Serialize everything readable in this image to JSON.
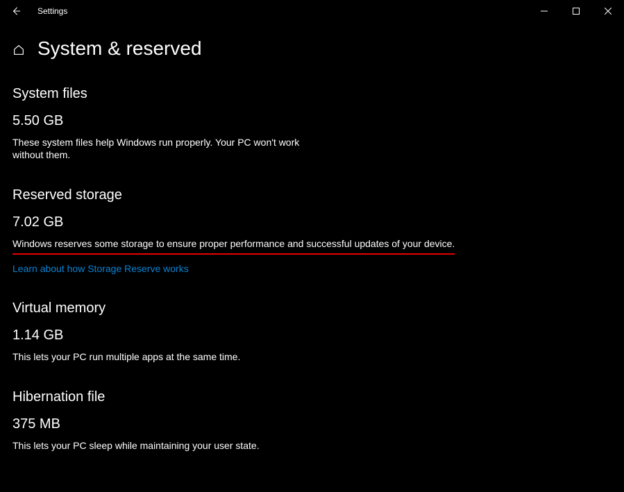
{
  "window": {
    "title": "Settings"
  },
  "page": {
    "title": "System & reserved"
  },
  "sections": {
    "system_files": {
      "heading": "System files",
      "size": "5.50 GB",
      "description": "These system files help Windows run properly. Your PC won't work without them."
    },
    "reserved_storage": {
      "heading": "Reserved storage",
      "size": "7.02 GB",
      "description": "Windows reserves some storage to ensure proper performance and successful updates of your device.",
      "link_label": "Learn about how Storage Reserve works"
    },
    "virtual_memory": {
      "heading": "Virtual memory",
      "size": "1.14 GB",
      "description": "This lets your PC run multiple apps at the same time."
    },
    "hibernation_file": {
      "heading": "Hibernation file",
      "size": "375 MB",
      "description": "This lets your PC sleep while maintaining your user state."
    }
  },
  "annotation": {
    "underline_color": "#e60000"
  }
}
